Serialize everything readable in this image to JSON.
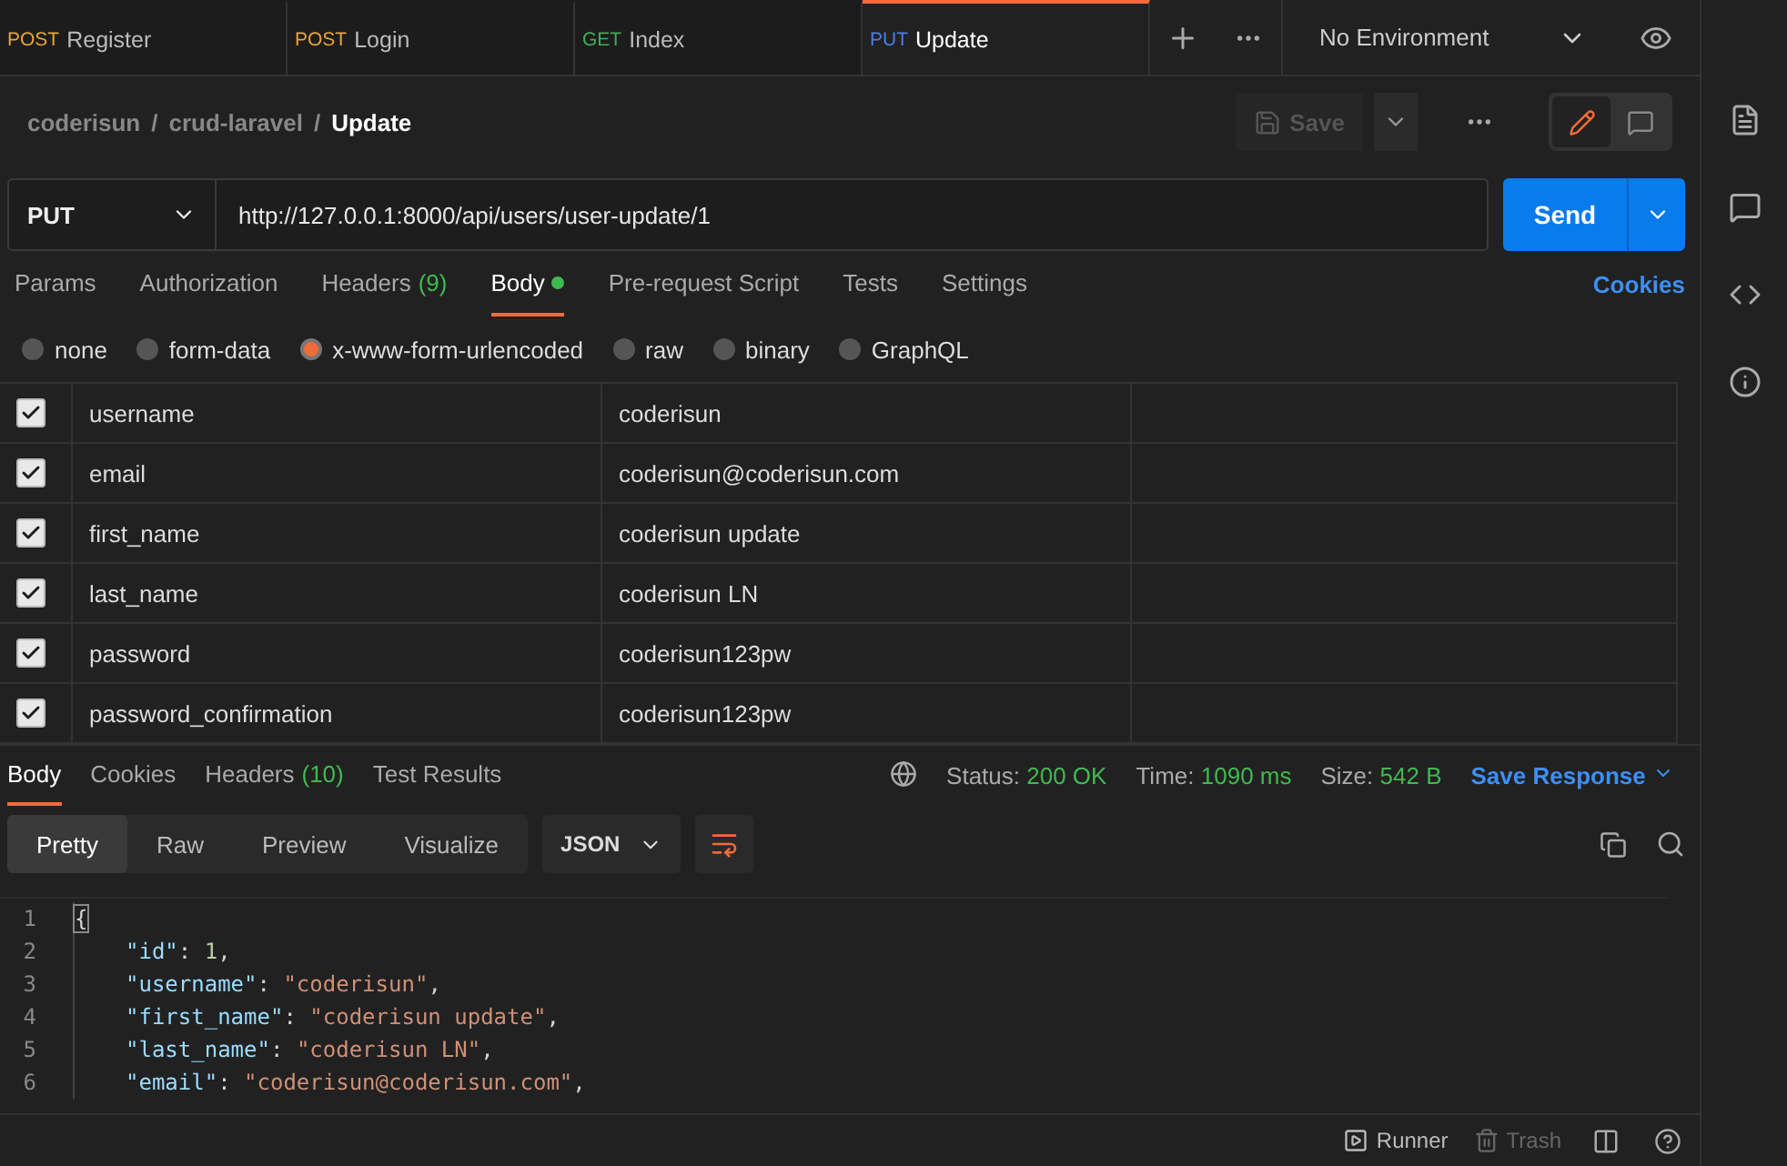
{
  "tabs": [
    {
      "method": "POST",
      "color": "#e5a43a",
      "label": "Register",
      "selected": false
    },
    {
      "method": "POST",
      "color": "#e5a43a",
      "label": "Login",
      "selected": false
    },
    {
      "method": "GET",
      "color": "#3fae5a",
      "label": "Index",
      "selected": false
    },
    {
      "method": "PUT",
      "color": "#4a7de8",
      "label": "Update",
      "selected": true
    }
  ],
  "environment": "No Environment",
  "breadcrumb": [
    "coderisun",
    "crud-laravel",
    "Update"
  ],
  "breadcrumb_separators": [
    "/",
    "/"
  ],
  "save_button": {
    "label": "Save",
    "disabled": true
  },
  "request": {
    "method": "PUT",
    "url": "http://127.0.0.1:8000/api/users/user-update/1",
    "send": "Send"
  },
  "request_tabs": [
    {
      "label": "Params",
      "selected": false,
      "indicator": false
    },
    {
      "label": "Authorization",
      "selected": false,
      "indicator": false
    },
    {
      "label": "Headers",
      "count": "(9)",
      "selected": false,
      "indicator": false
    },
    {
      "label": "Body",
      "selected": true,
      "indicator": true
    },
    {
      "label": "Pre-request Script",
      "selected": false,
      "indicator": false
    },
    {
      "label": "Tests",
      "selected": false,
      "indicator": false
    },
    {
      "label": "Settings",
      "selected": false,
      "indicator": false
    }
  ],
  "cookies_link": "Cookies",
  "body_types": [
    {
      "label": "none",
      "selected": false
    },
    {
      "label": "form-data",
      "selected": false
    },
    {
      "label": "x-www-form-urlencoded",
      "selected": true
    },
    {
      "label": "raw",
      "selected": false
    },
    {
      "label": "binary",
      "selected": false
    },
    {
      "label": "GraphQL",
      "selected": false
    }
  ],
  "params": [
    {
      "key": "username",
      "value": "coderisun",
      "checked": true
    },
    {
      "key": "email",
      "value": "coderisun@coderisun.com",
      "checked": true
    },
    {
      "key": "first_name",
      "value": "coderisun update",
      "checked": true
    },
    {
      "key": "last_name",
      "value": "coderisun LN",
      "checked": true
    },
    {
      "key": "password",
      "value": "coderisun123pw",
      "checked": true
    },
    {
      "key": "password_confirmation",
      "value": "coderisun123pw",
      "checked": true
    }
  ],
  "response_tabs": [
    {
      "label": "Body",
      "selected": true
    },
    {
      "label": "Cookies",
      "selected": false
    },
    {
      "label": "Headers",
      "count": "(10)",
      "selected": false
    },
    {
      "label": "Test Results",
      "selected": false
    }
  ],
  "response_meta": [
    {
      "label": "Status:",
      "value": "200 OK"
    },
    {
      "label": "Time:",
      "value": "1090 ms"
    },
    {
      "label": "Size:",
      "value": "542 B"
    }
  ],
  "save_response": "Save Response",
  "views": [
    {
      "label": "Pretty",
      "selected": true
    },
    {
      "label": "Raw",
      "selected": false
    },
    {
      "label": "Preview",
      "selected": false
    },
    {
      "label": "Visualize",
      "selected": false
    }
  ],
  "format": "JSON",
  "code_lines": [
    {
      "number": "1",
      "tokens": [
        {
          "kind": "brace",
          "text": "{"
        }
      ]
    },
    {
      "number": "2",
      "tokens": [
        {
          "kind": "key",
          "text": "\"id\""
        },
        {
          "kind": "punct",
          "text": ": "
        },
        {
          "kind": "number",
          "text": "1"
        },
        {
          "kind": "punct",
          "text": ","
        }
      ]
    },
    {
      "number": "3",
      "tokens": [
        {
          "kind": "key",
          "text": "\"username\""
        },
        {
          "kind": "punct",
          "text": ": "
        },
        {
          "kind": "string",
          "text": "\"coderisun\""
        },
        {
          "kind": "punct",
          "text": ","
        }
      ]
    },
    {
      "number": "4",
      "tokens": [
        {
          "kind": "key",
          "text": "\"first_name\""
        },
        {
          "kind": "punct",
          "text": ": "
        },
        {
          "kind": "string",
          "text": "\"coderisun update\""
        },
        {
          "kind": "punct",
          "text": ","
        }
      ]
    },
    {
      "number": "5",
      "tokens": [
        {
          "kind": "key",
          "text": "\"last_name\""
        },
        {
          "kind": "punct",
          "text": ": "
        },
        {
          "kind": "string",
          "text": "\"coderisun LN\""
        },
        {
          "kind": "punct",
          "text": ","
        }
      ]
    },
    {
      "number": "6",
      "tokens": [
        {
          "kind": "key",
          "text": "\"email\""
        },
        {
          "kind": "punct",
          "text": ": "
        },
        {
          "kind": "string",
          "text": "\"coderisun@coderisun.com\""
        },
        {
          "kind": "punct",
          "text": ","
        }
      ]
    }
  ],
  "footer": [
    {
      "label": "Runner",
      "disabled": false
    },
    {
      "label": "Trash",
      "disabled": true
    }
  ]
}
